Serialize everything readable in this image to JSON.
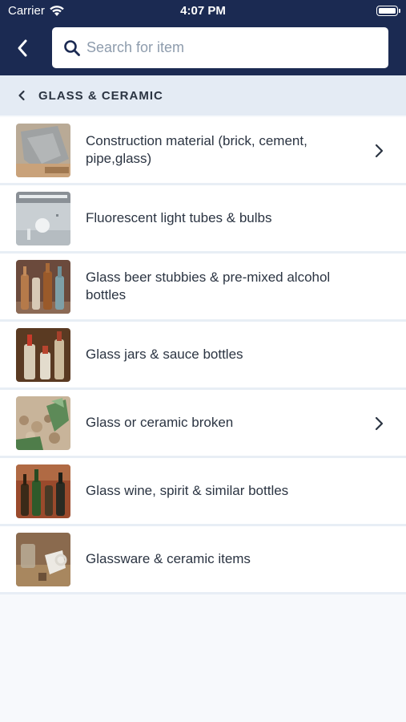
{
  "status_bar": {
    "carrier": "Carrier",
    "time": "4:07 PM"
  },
  "header": {
    "search_placeholder": "Search for item",
    "back_icon": "chevron-left-icon",
    "search_icon": "magnifier-icon"
  },
  "breadcrumb": {
    "label": "GLASS & CERAMIC"
  },
  "colors": {
    "nav": "#1b2a52",
    "breadcrumb_bg": "#e4ebf4",
    "text": "#2b3442",
    "placeholder": "#8e9cad"
  },
  "items": [
    {
      "label": "Construction material (brick, cement, pipe,glass)",
      "has_chevron": true,
      "thumbnail": "brick-photo"
    },
    {
      "label": "Fluorescent light tubes & bulbs",
      "has_chevron": false,
      "thumbnail": "bulbs-photo"
    },
    {
      "label": "Glass beer stubbies & pre-mixed alcohol bottles",
      "has_chevron": false,
      "thumbnail": "beer-bottles-photo"
    },
    {
      "label": "Glass jars & sauce bottles",
      "has_chevron": false,
      "thumbnail": "jars-photo"
    },
    {
      "label": "Glass or ceramic broken",
      "has_chevron": true,
      "thumbnail": "broken-glass-photo"
    },
    {
      "label": "Glass wine, spirit & similar bottles",
      "has_chevron": false,
      "thumbnail": "wine-bottles-photo"
    },
    {
      "label": "Glassware & ceramic items",
      "has_chevron": false,
      "thumbnail": "glassware-photo"
    }
  ]
}
